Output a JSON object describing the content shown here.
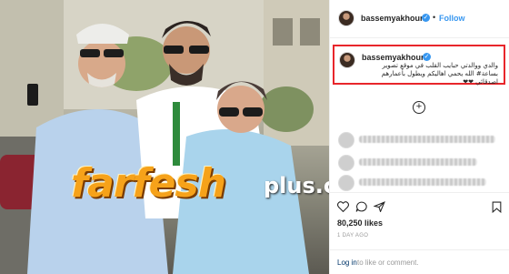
{
  "post": {
    "username": "bassemyakhour",
    "follow_label": "Follow",
    "separator": "•",
    "caption": "والدي ووالدتي حبايب القلب في موقع تصوير بساعة# الله يحمي اهاليكم ويطول بأعمارهم اصدقائي ❤❤",
    "likes": "80,250 likes",
    "time_ago": "1 DAY AGO",
    "login_link": "Log in",
    "login_rest": "to like or comment.",
    "load_more_icon": "plus-circle-icon"
  },
  "watermark": {
    "main": "farfesh",
    "sub": "plus.com"
  },
  "colors": {
    "accent_blue": "#3897f0",
    "highlight_red": "#e8262b",
    "watermark_orange": "#f6a21a"
  },
  "icons": [
    "heart-icon",
    "comment-icon",
    "share-icon",
    "bookmark-icon",
    "verified-badge-icon"
  ]
}
